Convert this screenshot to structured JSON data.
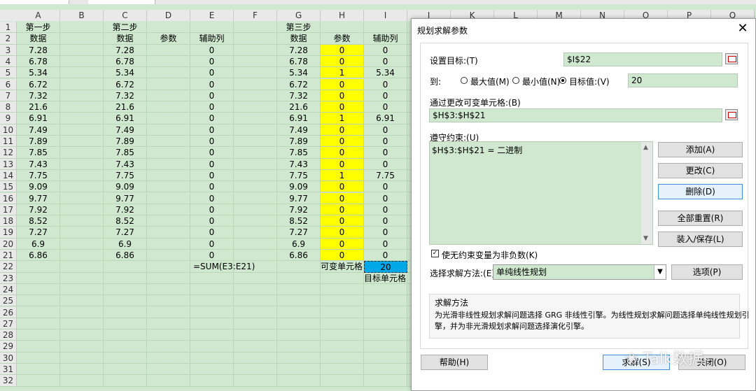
{
  "columns": [
    "A",
    "B",
    "C",
    "D",
    "E",
    "F",
    "G",
    "H",
    "I",
    "J",
    "K",
    "L",
    "M",
    "N",
    "O",
    "P",
    "Q"
  ],
  "rows": [
    {
      "n": "1",
      "A": "第一步",
      "C": "第二步",
      "G": "第三步"
    },
    {
      "n": "2",
      "A": "数据",
      "C": "数据",
      "D": "参数",
      "E": "辅助列",
      "G": "数据",
      "H": "参数",
      "I": "辅助列"
    },
    {
      "n": "3",
      "A": "7.28",
      "C": "7.28",
      "E": "0",
      "G": "7.28",
      "H": "0",
      "I": "0"
    },
    {
      "n": "4",
      "A": "6.78",
      "C": "6.78",
      "E": "0",
      "G": "6.78",
      "H": "0",
      "I": "0"
    },
    {
      "n": "5",
      "A": "5.34",
      "C": "5.34",
      "E": "0",
      "G": "5.34",
      "H": "1",
      "I": "5.34"
    },
    {
      "n": "6",
      "A": "6.72",
      "C": "6.72",
      "E": "0",
      "G": "6.72",
      "H": "0",
      "I": "0"
    },
    {
      "n": "7",
      "A": "7.32",
      "C": "7.32",
      "E": "0",
      "G": "7.32",
      "H": "0",
      "I": "0"
    },
    {
      "n": "8",
      "A": "21.6",
      "C": "21.6",
      "E": "0",
      "G": "21.6",
      "H": "0",
      "I": "0"
    },
    {
      "n": "9",
      "A": "6.91",
      "C": "6.91",
      "E": "0",
      "G": "6.91",
      "H": "1",
      "I": "6.91"
    },
    {
      "n": "10",
      "A": "7.49",
      "C": "7.49",
      "E": "0",
      "G": "7.49",
      "H": "0",
      "I": "0"
    },
    {
      "n": "11",
      "A": "7.89",
      "C": "7.89",
      "E": "0",
      "G": "7.89",
      "H": "0",
      "I": "0"
    },
    {
      "n": "12",
      "A": "7.85",
      "C": "7.85",
      "E": "0",
      "G": "7.85",
      "H": "0",
      "I": "0"
    },
    {
      "n": "13",
      "A": "7.43",
      "C": "7.43",
      "E": "0",
      "G": "7.43",
      "H": "0",
      "I": "0"
    },
    {
      "n": "14",
      "A": "7.75",
      "C": "7.75",
      "E": "0",
      "G": "7.75",
      "H": "1",
      "I": "7.75"
    },
    {
      "n": "15",
      "A": "9.09",
      "C": "9.09",
      "E": "0",
      "G": "9.09",
      "H": "0",
      "I": "0"
    },
    {
      "n": "16",
      "A": "9.77",
      "C": "9.77",
      "E": "0",
      "G": "9.77",
      "H": "0",
      "I": "0"
    },
    {
      "n": "17",
      "A": "7.92",
      "C": "7.92",
      "E": "0",
      "G": "7.92",
      "H": "0",
      "I": "0"
    },
    {
      "n": "18",
      "A": "8.52",
      "C": "8.52",
      "E": "0",
      "G": "8.52",
      "H": "0",
      "I": "0"
    },
    {
      "n": "19",
      "A": "7.27",
      "C": "7.27",
      "E": "0",
      "G": "7.27",
      "H": "0",
      "I": "0"
    },
    {
      "n": "20",
      "A": "6.9",
      "C": "6.9",
      "E": "0",
      "G": "6.9",
      "H": "0",
      "I": "0"
    },
    {
      "n": "21",
      "A": "6.86",
      "C": "6.86",
      "E": "0",
      "G": "6.86",
      "H": "0",
      "I": "0"
    },
    {
      "n": "22",
      "E": "=SUM(E3:E21)",
      "H": "可变单元格",
      "I": "20"
    },
    {
      "n": "23",
      "I": "目标单元格"
    },
    {
      "n": "24"
    },
    {
      "n": "25"
    },
    {
      "n": "26"
    },
    {
      "n": "27"
    },
    {
      "n": "28"
    },
    {
      "n": "29"
    },
    {
      "n": "30"
    },
    {
      "n": "31"
    },
    {
      "n": "32"
    }
  ],
  "dialog": {
    "title": "规划求解参数",
    "close": "✕",
    "set_objective_label": "设置目标:(T)",
    "objective_value": "$I$22",
    "to_label": "到:",
    "max_label": "最大值(M)",
    "min_label": "最小值(N)",
    "value_of_label": "目标值:(V)",
    "value_of": "20",
    "changing_cells_label": "通过更改可变单元格:(B)",
    "changing_cells": "$H$3:$H$21",
    "constraints_label": "遵守约束:(U)",
    "constraint_1": "$H$3:$H$21 = 二进制",
    "add": "添加(A)",
    "change": "更改(C)",
    "delete": "删除(D)",
    "reset_all": "全部重置(R)",
    "load_save": "装入/保存(L)",
    "nonneg_label": "使无约束变量为非负数(K)",
    "nonneg_checked": "✓",
    "method_label": "选择求解方法:(E)",
    "method_value": "单纯线性规划",
    "options": "选项(P)",
    "method_section_title": "求解方法",
    "method_desc_1": "为光滑非线性规划求解问题选择 GRG 非线性引擎。为线性规划求解问题选择单纯线性规划引",
    "method_desc_2": "擎，并为非光滑规划求解问题选择演化引擎。",
    "help": "帮助(H)",
    "solve": "求解(S)",
    "close_btn": "关闭(O)"
  },
  "watermark": "Talk数据"
}
